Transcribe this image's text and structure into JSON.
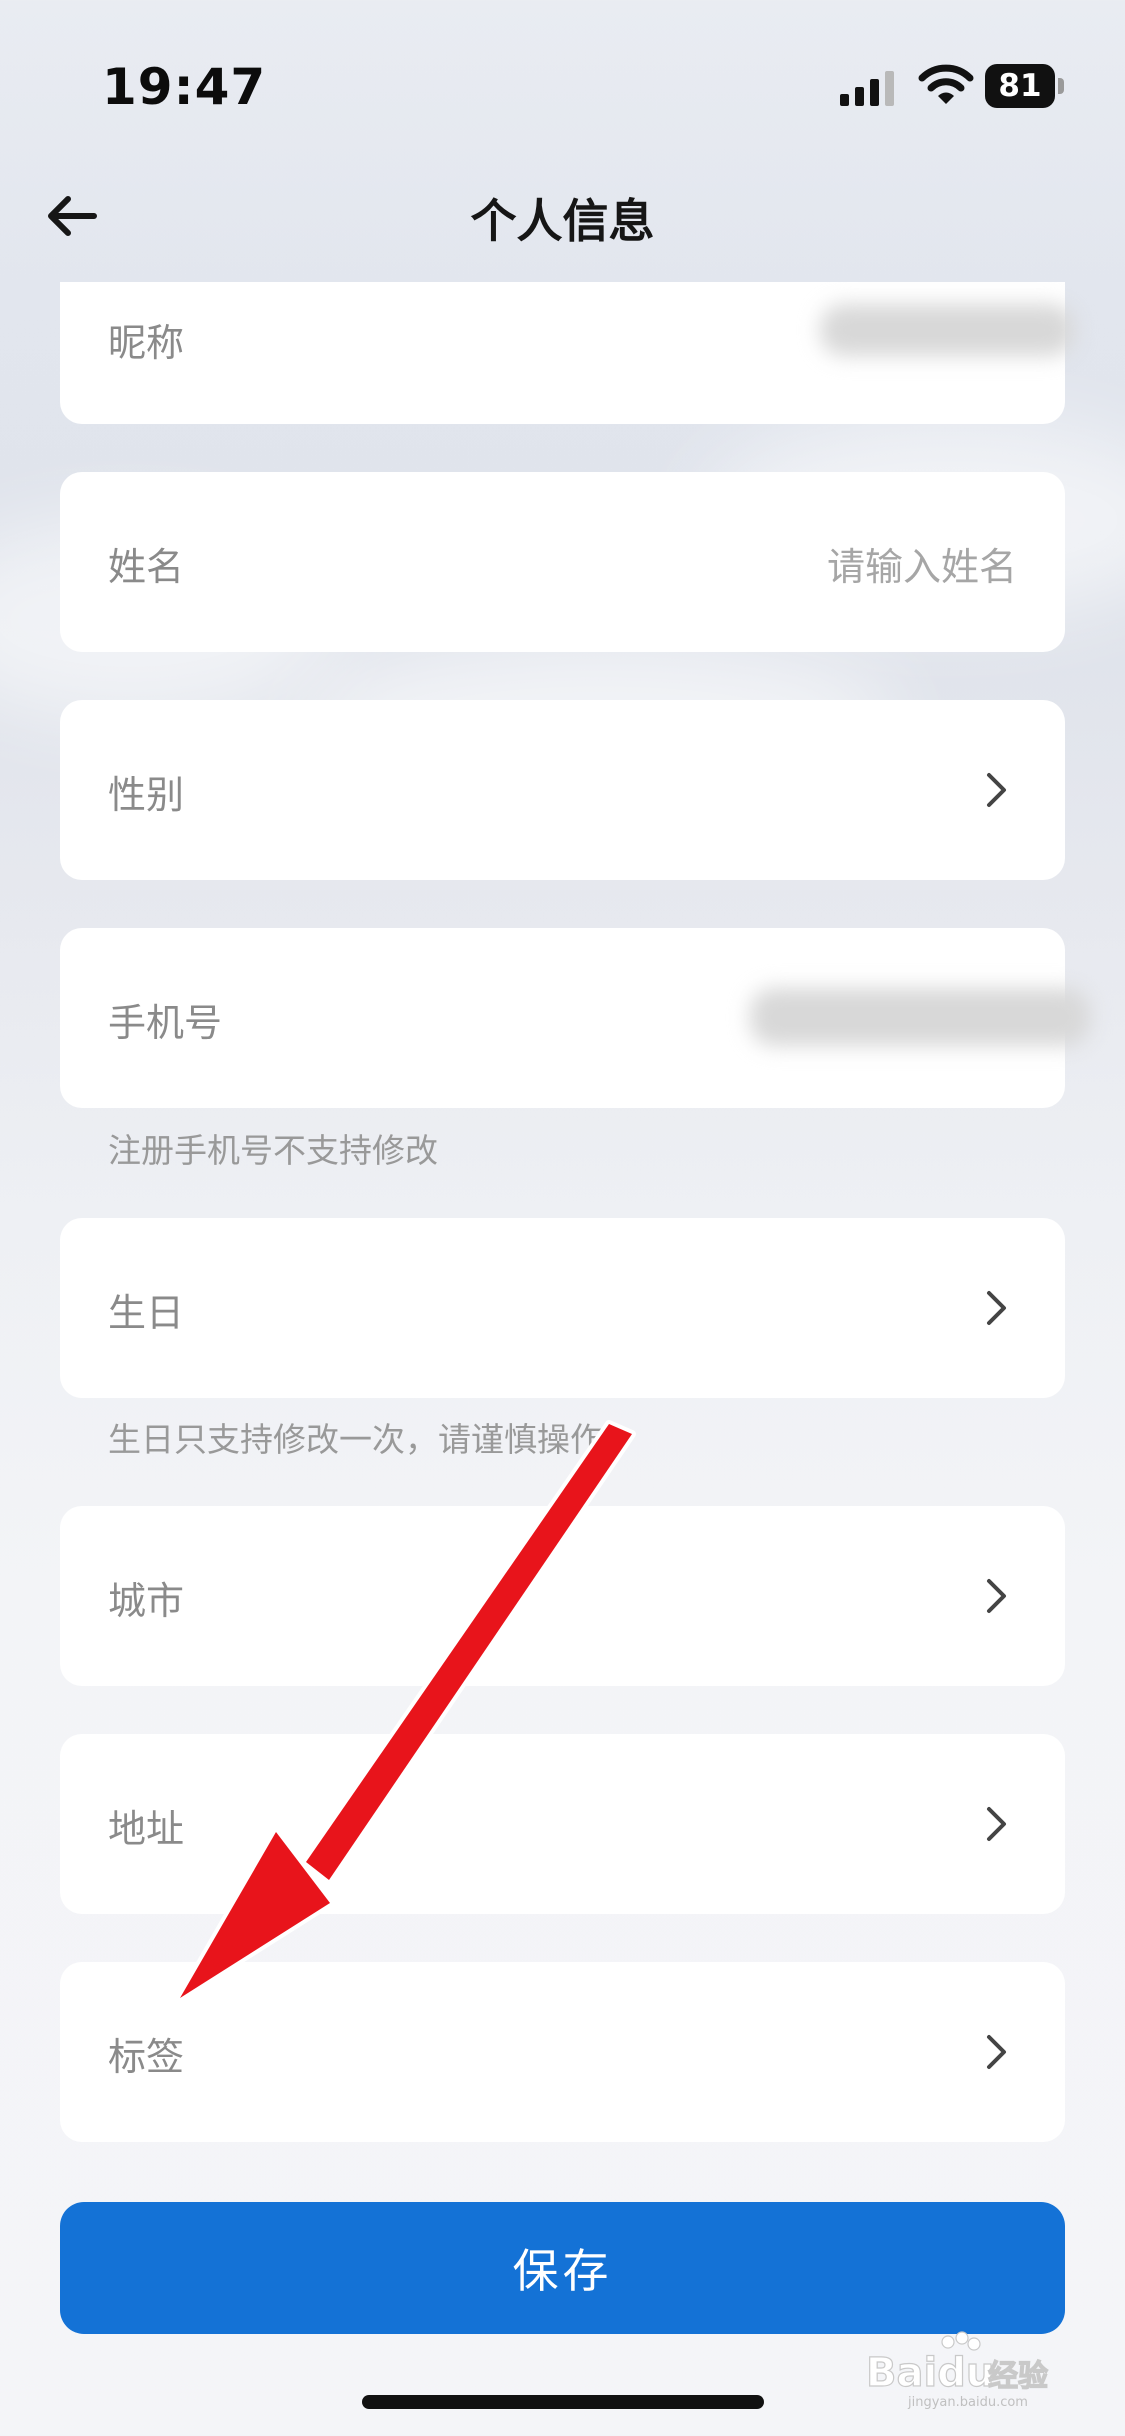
{
  "status_bar": {
    "time": "19:47",
    "battery": "81"
  },
  "nav": {
    "title": "个人信息"
  },
  "fields": {
    "nickname": {
      "label": "昵称"
    },
    "name": {
      "label": "姓名",
      "placeholder": "请输入姓名"
    },
    "gender": {
      "label": "性别"
    },
    "phone": {
      "label": "手机号",
      "hint": "注册手机号不支持修改"
    },
    "birthday": {
      "label": "生日",
      "hint": "生日只支持修改一次，请谨慎操作"
    },
    "city": {
      "label": "城市"
    },
    "address": {
      "label": "地址"
    },
    "tags": {
      "label": "标签"
    }
  },
  "save_button": {
    "label": "保存"
  },
  "watermark": {
    "text": "Baidu经验",
    "sub": "jingyan.baidu.com"
  },
  "colors": {
    "accent": "#1472d6",
    "annotation_arrow": "#e8141b"
  }
}
